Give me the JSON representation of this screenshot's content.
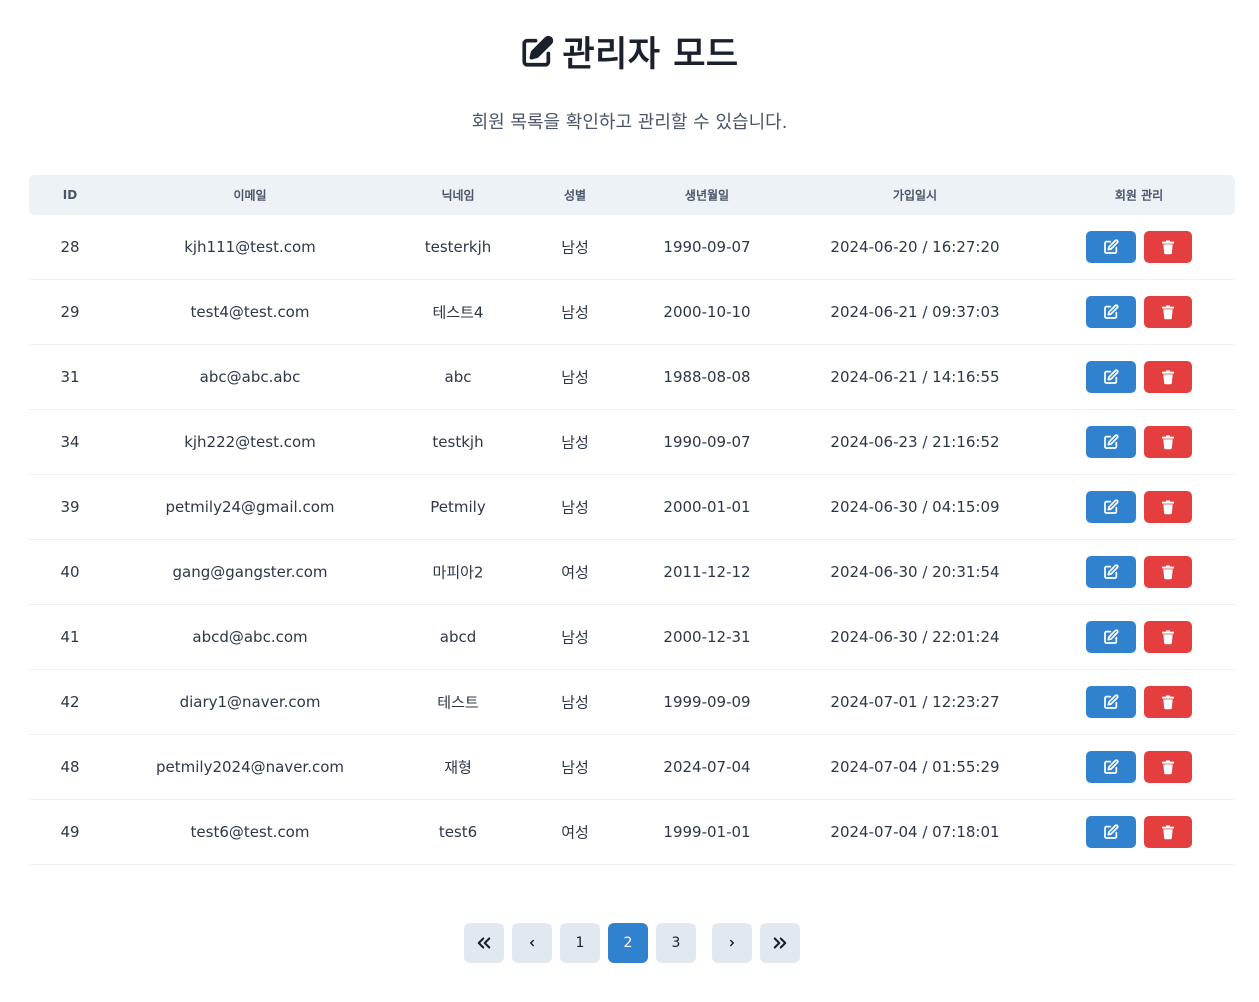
{
  "header": {
    "title": "관리자 모드",
    "subtitle": "회원 목록을 확인하고 관리할 수 있습니다.",
    "title_icon": "edit-icon"
  },
  "table": {
    "columns": [
      "ID",
      "이메일",
      "닉네임",
      "성별",
      "생년월일",
      "가입일시",
      "회원 관리"
    ],
    "rows": [
      {
        "id": "28",
        "email": "kjh111@test.com",
        "nickname": "testerkjh",
        "gender": "남성",
        "birth": "1990-09-07",
        "joined": "2024-06-20 / 16:27:20"
      },
      {
        "id": "29",
        "email": "test4@test.com",
        "nickname": "테스트4",
        "gender": "남성",
        "birth": "2000-10-10",
        "joined": "2024-06-21 / 09:37:03"
      },
      {
        "id": "31",
        "email": "abc@abc.abc",
        "nickname": "abc",
        "gender": "남성",
        "birth": "1988-08-08",
        "joined": "2024-06-21 / 14:16:55"
      },
      {
        "id": "34",
        "email": "kjh222@test.com",
        "nickname": "testkjh",
        "gender": "남성",
        "birth": "1990-09-07",
        "joined": "2024-06-23 / 21:16:52"
      },
      {
        "id": "39",
        "email": "petmily24@gmail.com",
        "nickname": "Petmily",
        "gender": "남성",
        "birth": "2000-01-01",
        "joined": "2024-06-30 / 04:15:09"
      },
      {
        "id": "40",
        "email": "gang@gangster.com",
        "nickname": "마피아2",
        "gender": "여성",
        "birth": "2011-12-12",
        "joined": "2024-06-30 / 20:31:54"
      },
      {
        "id": "41",
        "email": "abcd@abc.com",
        "nickname": "abcd",
        "gender": "남성",
        "birth": "2000-12-31",
        "joined": "2024-06-30 / 22:01:24"
      },
      {
        "id": "42",
        "email": "diary1@naver.com",
        "nickname": "테스트",
        "gender": "남성",
        "birth": "1999-09-09",
        "joined": "2024-07-01 / 12:23:27"
      },
      {
        "id": "48",
        "email": "petmily2024@naver.com",
        "nickname": "재형",
        "gender": "남성",
        "birth": "2024-07-04",
        "joined": "2024-07-04 / 01:55:29"
      },
      {
        "id": "49",
        "email": "test6@test.com",
        "nickname": "test6",
        "gender": "여성",
        "birth": "1999-01-01",
        "joined": "2024-07-04 / 07:18:01"
      }
    ],
    "row_actions": {
      "edit_icon": "edit-icon",
      "delete_icon": "trash-icon"
    }
  },
  "pagination": {
    "first_icon": "double-chevron-left-icon",
    "prev_icon": "chevron-left-icon",
    "pages": [
      "1",
      "2",
      "3"
    ],
    "current_page": "2",
    "next_icon": "chevron-right-icon",
    "last_icon": "double-chevron-right-icon"
  },
  "colors": {
    "primary": "#3182ce",
    "danger": "#e53e3e",
    "header_bg": "#edf2f7",
    "pager_bg": "#e2e8f0"
  }
}
